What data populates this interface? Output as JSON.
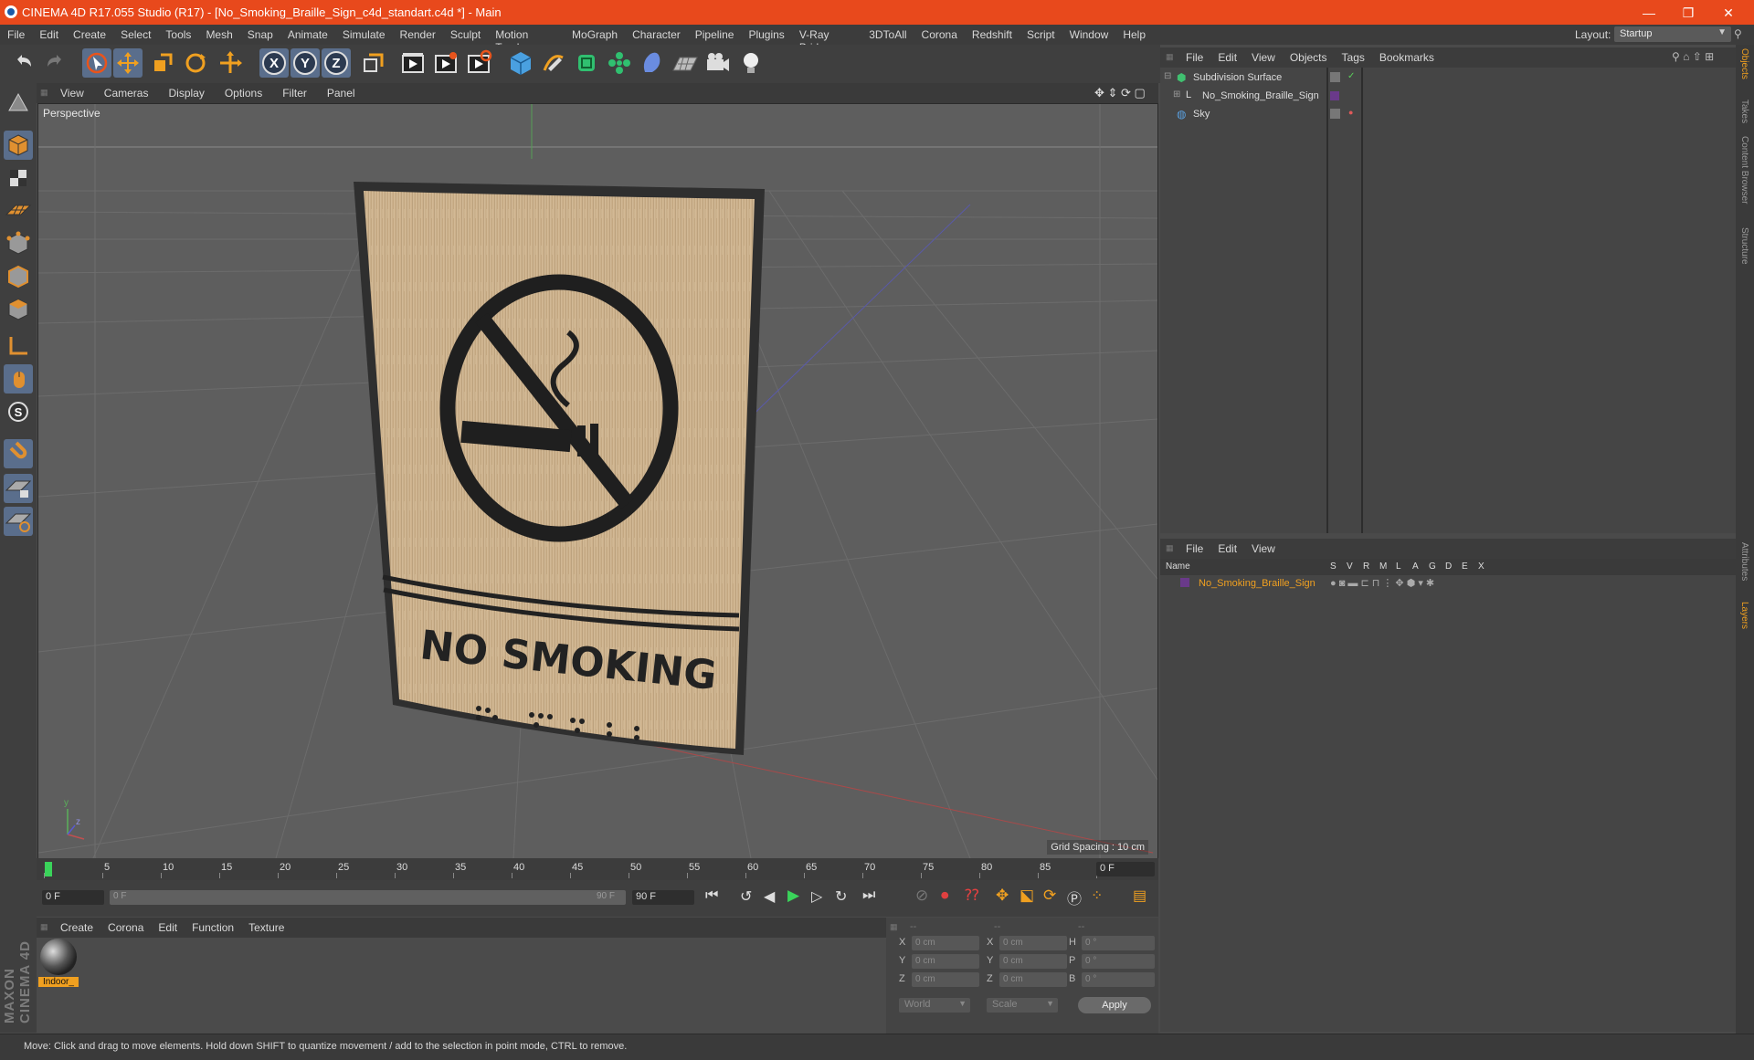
{
  "window": {
    "title": "CINEMA 4D R17.055 Studio (R17) - [No_Smoking_Braille_Sign_c4d_standart.c4d *] - Main",
    "minimize": "—",
    "maximize": "❐",
    "close": "✕"
  },
  "menubar": [
    "File",
    "Edit",
    "Create",
    "Select",
    "Tools",
    "Mesh",
    "Snap",
    "Animate",
    "Simulate",
    "Render",
    "Sculpt",
    "Motion Tracker",
    "MoGraph",
    "Character",
    "Pipeline",
    "Plugins",
    "V-Ray Bridge",
    "3DToAll",
    "Corona",
    "Redshift",
    "Script",
    "Window",
    "Help"
  ],
  "layout": {
    "label": "Layout:",
    "value": "Startup"
  },
  "viewport": {
    "menu": [
      "View",
      "Cameras",
      "Display",
      "Options",
      "Filter",
      "Panel"
    ],
    "camera_label": "Perspective",
    "grid_spacing": "Grid Spacing : 10 cm",
    "sign_text": "NO SMOKING"
  },
  "timeline": {
    "ticks": [
      "0",
      "5",
      "10",
      "15",
      "20",
      "25",
      "30",
      "35",
      "40",
      "45",
      "50",
      "55",
      "60",
      "65",
      "70",
      "75",
      "80",
      "85",
      "90"
    ],
    "current_frame": "0 F",
    "start_field": "0 F",
    "range_start": "0 F",
    "range_end": "90 F",
    "end_field": "90 F"
  },
  "material_panel": {
    "menu": [
      "Create",
      "Corona",
      "Edit",
      "Function",
      "Texture"
    ],
    "material_name": "Indoor_"
  },
  "coordinates": {
    "header": [
      "--",
      "--",
      "--"
    ],
    "rows": [
      {
        "l1": "X",
        "v1": "0 cm",
        "l2": "X",
        "v2": "0 cm",
        "l3": "H",
        "v3": "0 °"
      },
      {
        "l1": "Y",
        "v1": "0 cm",
        "l2": "Y",
        "v2": "0 cm",
        "l3": "P",
        "v3": "0 °"
      },
      {
        "l1": "Z",
        "v1": "0 cm",
        "l2": "Z",
        "v2": "0 cm",
        "l3": "B",
        "v3": "0 °"
      }
    ],
    "world": "World",
    "scale": "Scale",
    "apply": "Apply"
  },
  "object_manager": {
    "menu": [
      "File",
      "Edit",
      "View",
      "Objects",
      "Tags",
      "Bookmarks"
    ],
    "objects": [
      {
        "name": "Subdivision Surface"
      },
      {
        "name": "No_Smoking_Braille_Sign"
      },
      {
        "name": "Sky"
      }
    ]
  },
  "layer_manager": {
    "menu": [
      "File",
      "Edit",
      "View"
    ],
    "columns": [
      "Name",
      "S",
      "V",
      "R",
      "M",
      "L",
      "A",
      "G",
      "D",
      "E",
      "X"
    ],
    "layers": [
      {
        "name": "No_Smoking_Braille_Sign"
      }
    ]
  },
  "side_tabs": [
    "Objects",
    "Takes",
    "Content Browser",
    "Structure",
    "Attributes",
    "Layers"
  ],
  "branding": "MAXON CINEMA 4D",
  "status": "Move: Click and drag to move elements. Hold down SHIFT to quantize movement / add to the selection in point mode, CTRL to remove."
}
